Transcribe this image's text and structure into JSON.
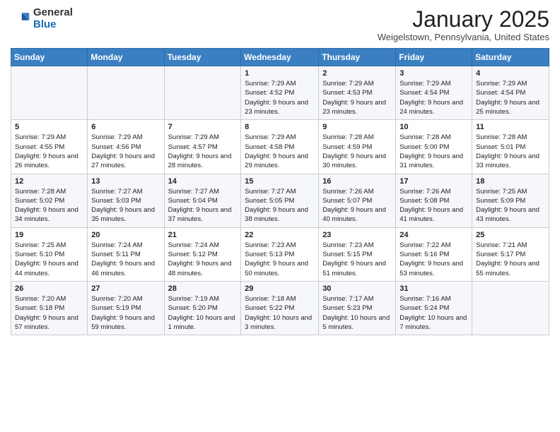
{
  "logo": {
    "general": "General",
    "blue": "Blue"
  },
  "header": {
    "month_year": "January 2025",
    "location": "Weigelstown, Pennsylvania, United States"
  },
  "weekdays": [
    "Sunday",
    "Monday",
    "Tuesday",
    "Wednesday",
    "Thursday",
    "Friday",
    "Saturday"
  ],
  "weeks": [
    [
      {
        "day": "",
        "info": ""
      },
      {
        "day": "",
        "info": ""
      },
      {
        "day": "",
        "info": ""
      },
      {
        "day": "1",
        "info": "Sunrise: 7:29 AM\nSunset: 4:52 PM\nDaylight: 9 hours and 23 minutes."
      },
      {
        "day": "2",
        "info": "Sunrise: 7:29 AM\nSunset: 4:53 PM\nDaylight: 9 hours and 23 minutes."
      },
      {
        "day": "3",
        "info": "Sunrise: 7:29 AM\nSunset: 4:54 PM\nDaylight: 9 hours and 24 minutes."
      },
      {
        "day": "4",
        "info": "Sunrise: 7:29 AM\nSunset: 4:54 PM\nDaylight: 9 hours and 25 minutes."
      }
    ],
    [
      {
        "day": "5",
        "info": "Sunrise: 7:29 AM\nSunset: 4:55 PM\nDaylight: 9 hours and 26 minutes."
      },
      {
        "day": "6",
        "info": "Sunrise: 7:29 AM\nSunset: 4:56 PM\nDaylight: 9 hours and 27 minutes."
      },
      {
        "day": "7",
        "info": "Sunrise: 7:29 AM\nSunset: 4:57 PM\nDaylight: 9 hours and 28 minutes."
      },
      {
        "day": "8",
        "info": "Sunrise: 7:29 AM\nSunset: 4:58 PM\nDaylight: 9 hours and 29 minutes."
      },
      {
        "day": "9",
        "info": "Sunrise: 7:28 AM\nSunset: 4:59 PM\nDaylight: 9 hours and 30 minutes."
      },
      {
        "day": "10",
        "info": "Sunrise: 7:28 AM\nSunset: 5:00 PM\nDaylight: 9 hours and 31 minutes."
      },
      {
        "day": "11",
        "info": "Sunrise: 7:28 AM\nSunset: 5:01 PM\nDaylight: 9 hours and 33 minutes."
      }
    ],
    [
      {
        "day": "12",
        "info": "Sunrise: 7:28 AM\nSunset: 5:02 PM\nDaylight: 9 hours and 34 minutes."
      },
      {
        "day": "13",
        "info": "Sunrise: 7:27 AM\nSunset: 5:03 PM\nDaylight: 9 hours and 35 minutes."
      },
      {
        "day": "14",
        "info": "Sunrise: 7:27 AM\nSunset: 5:04 PM\nDaylight: 9 hours and 37 minutes."
      },
      {
        "day": "15",
        "info": "Sunrise: 7:27 AM\nSunset: 5:05 PM\nDaylight: 9 hours and 38 minutes."
      },
      {
        "day": "16",
        "info": "Sunrise: 7:26 AM\nSunset: 5:07 PM\nDaylight: 9 hours and 40 minutes."
      },
      {
        "day": "17",
        "info": "Sunrise: 7:26 AM\nSunset: 5:08 PM\nDaylight: 9 hours and 41 minutes."
      },
      {
        "day": "18",
        "info": "Sunrise: 7:25 AM\nSunset: 5:09 PM\nDaylight: 9 hours and 43 minutes."
      }
    ],
    [
      {
        "day": "19",
        "info": "Sunrise: 7:25 AM\nSunset: 5:10 PM\nDaylight: 9 hours and 44 minutes."
      },
      {
        "day": "20",
        "info": "Sunrise: 7:24 AM\nSunset: 5:11 PM\nDaylight: 9 hours and 46 minutes."
      },
      {
        "day": "21",
        "info": "Sunrise: 7:24 AM\nSunset: 5:12 PM\nDaylight: 9 hours and 48 minutes."
      },
      {
        "day": "22",
        "info": "Sunrise: 7:23 AM\nSunset: 5:13 PM\nDaylight: 9 hours and 50 minutes."
      },
      {
        "day": "23",
        "info": "Sunrise: 7:23 AM\nSunset: 5:15 PM\nDaylight: 9 hours and 51 minutes."
      },
      {
        "day": "24",
        "info": "Sunrise: 7:22 AM\nSunset: 5:16 PM\nDaylight: 9 hours and 53 minutes."
      },
      {
        "day": "25",
        "info": "Sunrise: 7:21 AM\nSunset: 5:17 PM\nDaylight: 9 hours and 55 minutes."
      }
    ],
    [
      {
        "day": "26",
        "info": "Sunrise: 7:20 AM\nSunset: 5:18 PM\nDaylight: 9 hours and 57 minutes."
      },
      {
        "day": "27",
        "info": "Sunrise: 7:20 AM\nSunset: 5:19 PM\nDaylight: 9 hours and 59 minutes."
      },
      {
        "day": "28",
        "info": "Sunrise: 7:19 AM\nSunset: 5:20 PM\nDaylight: 10 hours and 1 minute."
      },
      {
        "day": "29",
        "info": "Sunrise: 7:18 AM\nSunset: 5:22 PM\nDaylight: 10 hours and 3 minutes."
      },
      {
        "day": "30",
        "info": "Sunrise: 7:17 AM\nSunset: 5:23 PM\nDaylight: 10 hours and 5 minutes."
      },
      {
        "day": "31",
        "info": "Sunrise: 7:16 AM\nSunset: 5:24 PM\nDaylight: 10 hours and 7 minutes."
      },
      {
        "day": "",
        "info": ""
      }
    ]
  ]
}
